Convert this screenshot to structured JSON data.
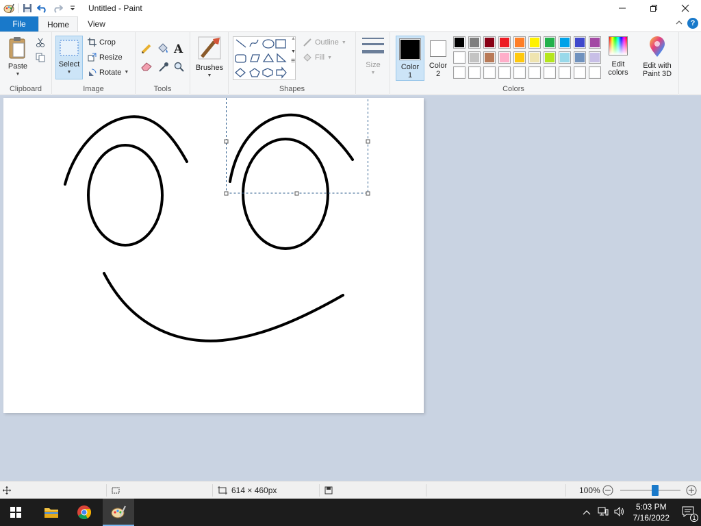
{
  "window": {
    "title": "Untitled - Paint"
  },
  "tabs": {
    "file": "File",
    "home": "Home",
    "view": "View"
  },
  "ribbon": {
    "clipboard": {
      "label": "Clipboard",
      "paste": "Paste"
    },
    "image": {
      "label": "Image",
      "select": "Select",
      "crop": "Crop",
      "resize": "Resize",
      "rotate": "Rotate"
    },
    "tools": {
      "label": "Tools"
    },
    "brushes": {
      "label": "Brushes"
    },
    "shapes": {
      "label": "Shapes",
      "outline": "Outline",
      "fill": "Fill"
    },
    "size": {
      "label": "Size"
    },
    "colors": {
      "label": "Colors",
      "color1_label": "Color",
      "color1_num": "1",
      "color2_label": "Color",
      "color2_num": "2",
      "color1": "#000000",
      "color2": "#ffffff",
      "edit_colors_1": "Edit",
      "edit_colors_2": "colors",
      "paint3d_1": "Edit with",
      "paint3d_2": "Paint 3D",
      "palette_row1": [
        "#000000",
        "#7f7f7f",
        "#880015",
        "#ed1c24",
        "#ff7f27",
        "#fff200",
        "#22b14c",
        "#00a2e8",
        "#3f48cc",
        "#a349a4"
      ],
      "palette_row2": [
        "#ffffff",
        "#c3c3c3",
        "#b97a57",
        "#ffaec9",
        "#ffc90e",
        "#efe4b0",
        "#b5e61d",
        "#99d9ea",
        "#7092be",
        "#c8bfe7"
      ],
      "palette_row3": [
        "#ffffff",
        "#ffffff",
        "#ffffff",
        "#ffffff",
        "#ffffff",
        "#ffffff",
        "#ffffff",
        "#ffffff",
        "#ffffff",
        "#ffffff"
      ]
    }
  },
  "status": {
    "canvas_size": "614 × 460px",
    "zoom": "100%",
    "zoom_level": 0.58
  },
  "taskbar": {
    "time": "5:03 PM",
    "date": "7/16/2022",
    "notifications": "1"
  }
}
